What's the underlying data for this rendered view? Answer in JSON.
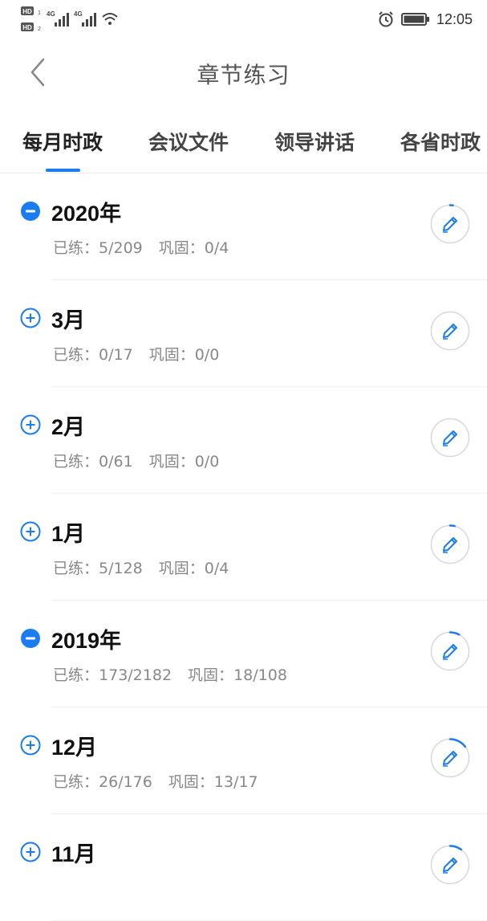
{
  "status_bar": {
    "time": "12:05",
    "icons": [
      "hd-icon",
      "signal-4g-icon",
      "signal-4g-icon",
      "wifi-icon",
      "alarm-icon",
      "battery-icon"
    ]
  },
  "header": {
    "title": "章节练习",
    "back_icon": "chevron-left-icon"
  },
  "tabs": [
    {
      "label": "每月时政",
      "active": true
    },
    {
      "label": "会议文件",
      "active": false
    },
    {
      "label": "领导讲话",
      "active": false
    },
    {
      "label": "各省时政",
      "active": false
    }
  ],
  "colors": {
    "accent": "#1a7cf0",
    "muted_text": "#888888",
    "circle_border": "#d8d8d8"
  },
  "list": [
    {
      "title": "2020年",
      "practiced_label": "已练：",
      "practiced": "5/209",
      "consolidated_label": "巩固：",
      "consolidated": "0/4",
      "expanded": true,
      "progress": 0.024
    },
    {
      "title": "3月",
      "practiced_label": "已练：",
      "practiced": "0/17",
      "consolidated_label": "巩固：",
      "consolidated": "0/0",
      "expanded": false,
      "progress": 0
    },
    {
      "title": "2月",
      "practiced_label": "已练：",
      "practiced": "0/61",
      "consolidated_label": "巩固：",
      "consolidated": "0/0",
      "expanded": false,
      "progress": 0
    },
    {
      "title": "1月",
      "practiced_label": "已练：",
      "practiced": "5/128",
      "consolidated_label": "巩固：",
      "consolidated": "0/4",
      "expanded": false,
      "progress": 0.039
    },
    {
      "title": "2019年",
      "practiced_label": "已练：",
      "practiced": "173/2182",
      "consolidated_label": "巩固：",
      "consolidated": "18/108",
      "expanded": true,
      "progress": 0.079
    },
    {
      "title": "12月",
      "practiced_label": "已练：",
      "practiced": "26/176",
      "consolidated_label": "巩固：",
      "consolidated": "13/17",
      "expanded": false,
      "progress": 0.148
    },
    {
      "title": "11月",
      "practiced_label": "",
      "practiced": "",
      "consolidated_label": "",
      "consolidated": "",
      "expanded": false,
      "progress": 0.1
    }
  ]
}
